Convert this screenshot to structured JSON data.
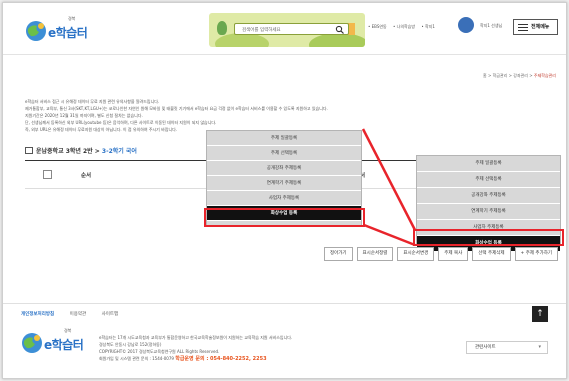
{
  "header": {
    "logo_sup": "경북",
    "logo_text": "e학습터",
    "search_placeholder": "검색어를 입력하세요",
    "util_links": [
      "• EBS연동",
      "• 나의학습방",
      "• 학지1"
    ],
    "user_name": "학지1 선생님",
    "menu_label": "전체메뉴"
  },
  "breadcrumb": {
    "home": "홈",
    "sep1": " > ",
    "item1": "학급관리",
    "sep2": " > ",
    "item2": "강좌관리",
    "sep3": " > ",
    "current": "주제학습관리"
  },
  "notice": [
    "e학습터 서비스 접근 시 유해정 데이터 무료 지원 관련 유의사항을 알려드립니다.",
    "제거통합부, 교육부, 통신 3사(SKT,KT,LGU+)는 코로나인한 자연인 원해 모바일 및 태블릿 기기에서 e학습터 요금 걱정 없이 e학습터 서비스를 이용할 수 있도록 지원하고 있습니다.",
    "지원기간은 2020년 12월 31일 까지이며, 별도 신청 절차는 없습니다.",
    "단, 선생님께서 등록하신 외부 URL(youtube 등)은 음악하며, 다른 사이트로 이동된 데이터 지원이 되지 않습니다.",
    "즉, 외부 URL은 유해정 데이터 무료지원 대상이 아닙니다. 이 점 유의하여 주시기 바랍니다."
  ],
  "course": {
    "school": "운남중학교 3학년 2반",
    "arrow": " > ",
    "subject": "3-2학기 국어"
  },
  "table": {
    "col_order": "순서",
    "col_order2": "순서"
  },
  "popup_main": {
    "items": [
      "주제 일괄등록",
      "주제 선택등록",
      "공개강좌 주제등록",
      "연계학기 주제등록",
      "사업자 주제등록",
      "화상수업 등록"
    ],
    "active_index": 5
  },
  "popup_zoom": {
    "items": [
      "주제 일괄등록",
      "주제 선택등록",
      "공개강좌 주제등록",
      "연계학기 주제등록",
      "사업자 주제등록",
      "화상수업 등록"
    ],
    "active_index": 5
  },
  "actions": [
    "정아가기",
    "표시순서정렬",
    "표시순서변경",
    "주제 복사",
    "선택 주제삭제",
    "+ 주제 추가하기"
  ],
  "footer": {
    "links": [
      "개인정보처리방침",
      "이용약관",
      "사이트맵"
    ],
    "logo_sup": "경북",
    "logo_text": "e학습터",
    "info": [
      "e학습터는 17개 시도교육청과 교육부가 통합운영하고 한국교육학술정보원이 지원하는 교육학습 지원 서비스입니다.",
      "경상북도 안동시 강남로 152(정하동)",
      "COPYRIGHT© 2017 경상북도교육청연구원 ALL Rights Reserved."
    ],
    "phone_prefix": "회원가입 및 시스템 관련 문의 : 1544-0079",
    "phone_label": "학급운영 문의 : 054-840-2252, 2253",
    "related_label": "관련사이트",
    "top_label": "↑"
  },
  "colors": {
    "brand_blue": "#2a72c6",
    "highlight_red": "#e8242b",
    "active_black": "#111111"
  }
}
